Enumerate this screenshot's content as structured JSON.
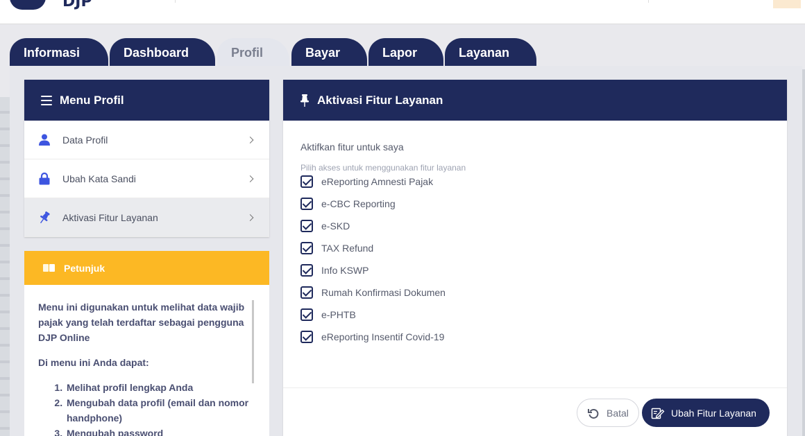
{
  "header": {
    "logo_text": "DJP"
  },
  "tabs": [
    {
      "label": "Informasi"
    },
    {
      "label": "Dashboard"
    },
    {
      "label": "Profil",
      "active": true
    },
    {
      "label": "Bayar"
    },
    {
      "label": "Lapor"
    },
    {
      "label": "Layanan"
    }
  ],
  "menu": {
    "title": "Menu Profil",
    "items": [
      {
        "label": "Data Profil",
        "icon": "user-icon"
      },
      {
        "label": "Ubah Kata Sandi",
        "icon": "lock-icon"
      },
      {
        "label": "Aktivasi Fitur Layanan",
        "icon": "pin-icon",
        "active": true
      }
    ]
  },
  "guide": {
    "title": "Petunjuk",
    "intro": "Menu ini digunakan untuk melihat data wajib pajak yang telah terdaftar sebagai pengguna DJP Online",
    "subtitle": "Di menu ini Anda dapat:",
    "steps": [
      "Melihat profil lengkap Anda",
      "Mengubah data profil (email dan nomor handphone)",
      "Mengubah password"
    ]
  },
  "activation": {
    "title": "Aktivasi Fitur Layanan",
    "prompt": "Aktifkan fitur untuk saya",
    "hint": "Pilih akses untuk menggunakan fitur layanan",
    "options": [
      {
        "label": "eReporting Amnesti Pajak",
        "checked": true
      },
      {
        "label": "e-CBC Reporting",
        "checked": true
      },
      {
        "label": "e-SKD",
        "checked": true
      },
      {
        "label": "TAX Refund",
        "checked": true
      },
      {
        "label": "Info KSWP",
        "checked": true
      },
      {
        "label": "Rumah Konfirmasi Dokumen",
        "checked": true
      },
      {
        "label": "e-PHTB",
        "checked": true
      },
      {
        "label": "eReporting Insentif Covid-19",
        "checked": true
      }
    ],
    "cancel_label": "Batal",
    "submit_label": "Ubah Fitur Layanan"
  },
  "colors": {
    "primary": "#1f2a5c",
    "accent": "#fcb824",
    "icon": "#3d55e0"
  }
}
